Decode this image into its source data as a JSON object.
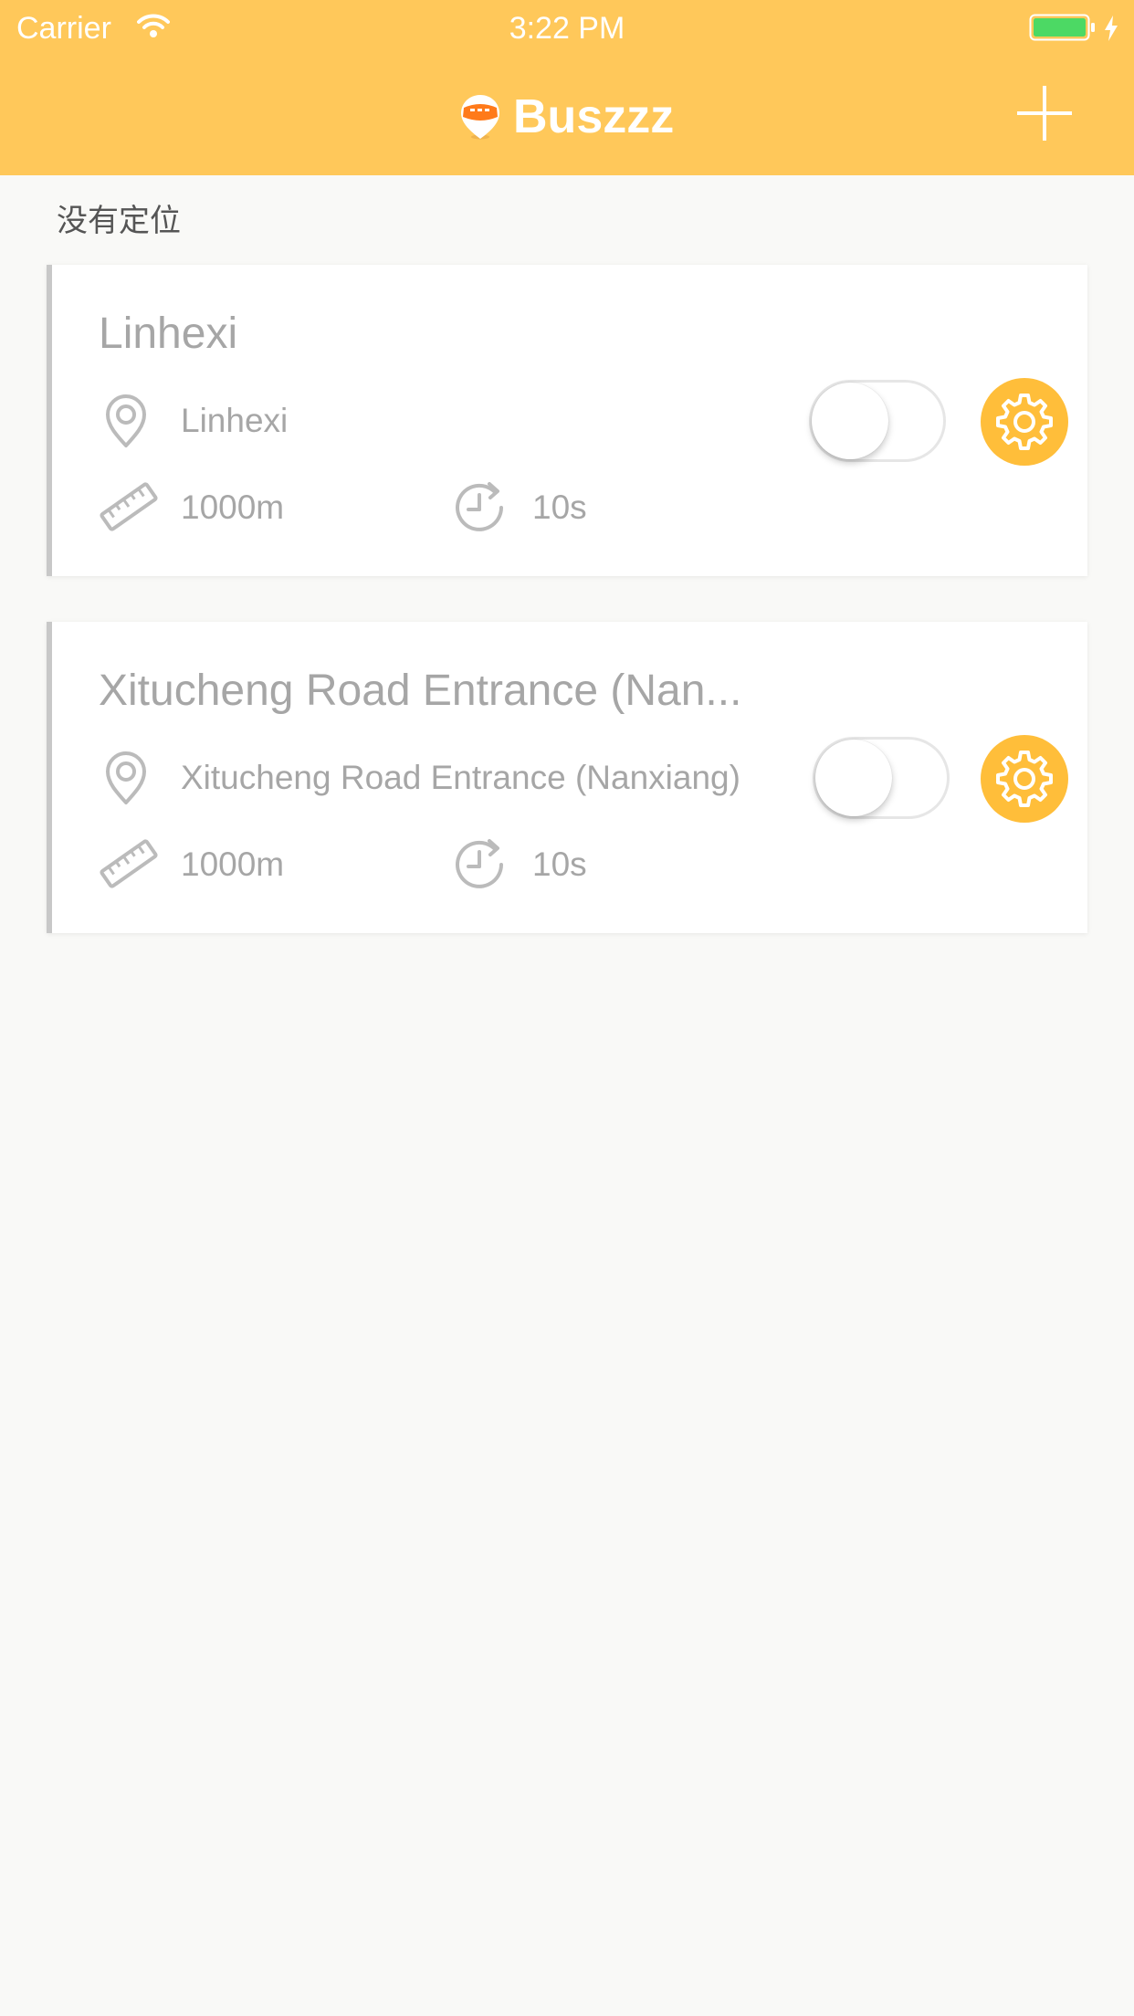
{
  "status_bar": {
    "carrier": "Carrier",
    "time": "3:22 PM"
  },
  "header": {
    "title": "Buszzz",
    "add_icon": "plus-icon",
    "logo_icon": "bus-logo-icon"
  },
  "location_status": "没有定位",
  "colors": {
    "accent": "#ffc85a",
    "gear": "#ffbe3a",
    "text_muted": "#a6a6a6",
    "background": "#f9f9f7"
  },
  "alarms": [
    {
      "title": "Linhexi",
      "stop": "Linhexi",
      "distance": "1000m",
      "interval": "10s",
      "enabled": false
    },
    {
      "title": "Xitucheng Road Entrance (Nan...",
      "stop": "Xitucheng Road Entrance (Nanxiang)",
      "distance": "1000m",
      "interval": "10s",
      "enabled": false
    }
  ]
}
